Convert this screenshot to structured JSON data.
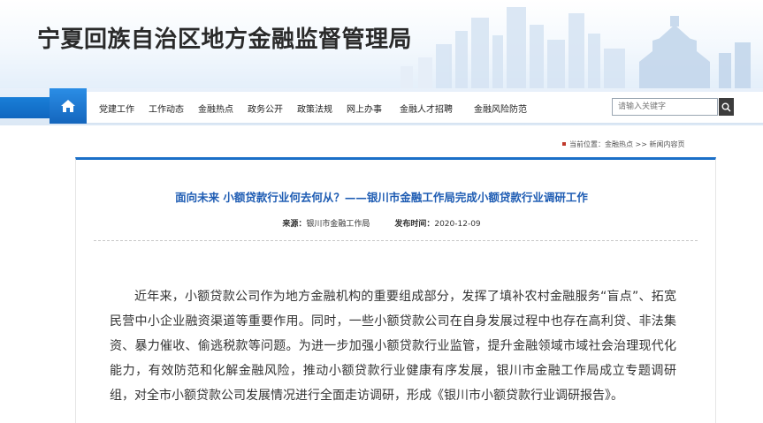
{
  "header": {
    "site_title": "宁夏回族自治区地方金融监督管理局"
  },
  "nav": {
    "items": [
      {
        "label": "党建工作"
      },
      {
        "label": "工作动态"
      },
      {
        "label": "金融热点"
      },
      {
        "label": "政务公开"
      },
      {
        "label": "政策法规"
      },
      {
        "label": "网上办事"
      },
      {
        "label": "金融人才招聘"
      },
      {
        "label": "金融风险防范"
      }
    ]
  },
  "search": {
    "placeholder": "请输入关键字"
  },
  "breadcrumb": {
    "prefix": "当前位置：",
    "link": "金融热点",
    "separator": " >> ",
    "current": "新闻内容页"
  },
  "article": {
    "title": "面向未来 小额贷款行业何去何从？——银川市金融工作局完成小额贷款行业调研工作",
    "source_label": "来源：",
    "source": "银川市金融工作局",
    "date_label": "发布时间：",
    "date": "2020-12-09",
    "body": "近年来，小额贷款公司作为地方金融机构的重要组成部分，发挥了填补农村金融服务“盲点”、拓宽民营中小企业融资渠道等重要作用。同时，一些小额贷款公司在自身发展过程中也存在高利贷、非法集资、暴力催收、偷逃税款等问题。为进一步加强小额贷款行业监管，提升金融领域市域社会治理现代化能力，有效防范和化解金融风险，推动小额贷款行业健康有序发展，银川市金融工作局成立专题调研组，对全市小额贷款公司发展情况进行全面走访调研，形成《银川市小额贷款行业调研报告》。"
  },
  "colors": {
    "brand_blue": "#1a6fc8",
    "title_blue": "#1e5cb3",
    "breadcrumb_marker": "#c0392b"
  },
  "icons": {
    "home": "home-icon",
    "search": "search-icon",
    "skyline": "city-skyline-decoration"
  }
}
